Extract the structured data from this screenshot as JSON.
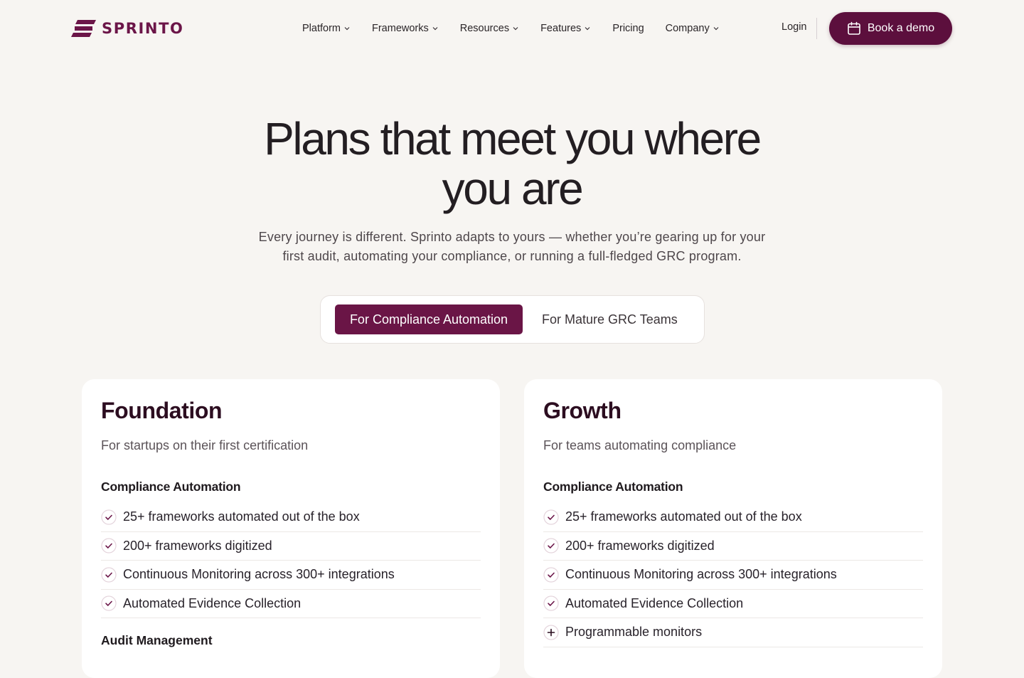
{
  "brand": {
    "name": "SPRINTO",
    "color": "#6b1548"
  },
  "nav": {
    "items": [
      {
        "label": "Platform",
        "has_dropdown": true
      },
      {
        "label": "Frameworks",
        "has_dropdown": true
      },
      {
        "label": "Resources",
        "has_dropdown": true
      },
      {
        "label": "Features",
        "has_dropdown": true
      },
      {
        "label": "Pricing",
        "has_dropdown": false
      },
      {
        "label": "Company",
        "has_dropdown": true
      }
    ],
    "login_label": "Login",
    "demo_label": "Book a demo"
  },
  "hero": {
    "title_line1": "Plans that meet you where",
    "title_line2": "you are",
    "subtitle_line1": "Every journey is different. Sprinto adapts to yours — whether you’re gearing up for your",
    "subtitle_line2": "first audit, automating your compliance, or running a full-fledged GRC program."
  },
  "toggle": {
    "active_label": "For Compliance Automation",
    "inactive_label": "For Mature GRC Teams"
  },
  "colors": {
    "accent": "#5c0f3d",
    "toggle_active": "#6a1546"
  },
  "plans": [
    {
      "name": "Foundation",
      "description": "For startups on their first certification",
      "section_title": "Compliance Automation",
      "features": [
        {
          "text": "25+ frameworks automated out of the box",
          "icon": "check-icon"
        },
        {
          "text": "200+ frameworks digitized",
          "icon": "check-icon"
        },
        {
          "text": "Continuous Monitoring across 300+ integrations",
          "icon": "check-icon"
        },
        {
          "text": "Automated Evidence Collection",
          "icon": "check-icon"
        }
      ],
      "next_section_title": "Audit Management"
    },
    {
      "name": "Growth",
      "description": "For teams automating compliance",
      "section_title": "Compliance Automation",
      "features": [
        {
          "text": "25+ frameworks automated out of the box",
          "icon": "check-icon"
        },
        {
          "text": "200+ frameworks digitized",
          "icon": "check-icon"
        },
        {
          "text": "Continuous Monitoring across 300+ integrations",
          "icon": "check-icon"
        },
        {
          "text": "Automated Evidence Collection",
          "icon": "check-icon"
        },
        {
          "text": "Programmable monitors",
          "icon": "plus-icon"
        }
      ]
    }
  ]
}
